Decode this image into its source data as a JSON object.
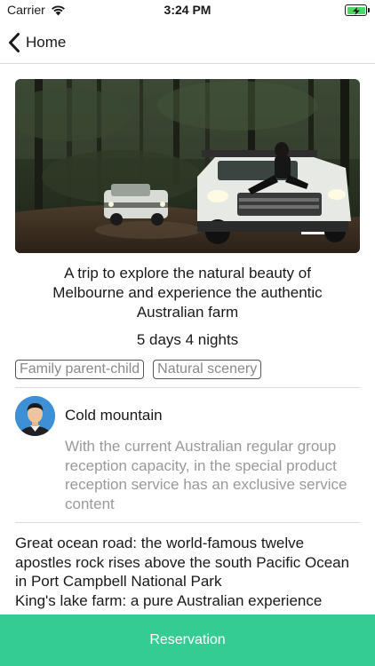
{
  "status_bar": {
    "carrier": "Carrier",
    "time": "3:24 PM",
    "battery_color": "#4cd964"
  },
  "nav": {
    "back_label": "Home",
    "back_icon": "chevron-left-icon"
  },
  "trip": {
    "title": "A trip to explore the natural beauty of Melbourne and experience the authentic Australian farm",
    "duration": "5 days 4 nights",
    "tags": [
      "Family parent-child",
      "Natural scenery"
    ]
  },
  "author": {
    "name": "Cold mountain",
    "description": "With the current Australian regular group reception capacity, in the special product reception service has an exclusive service content"
  },
  "description": "Great ocean road: the world-famous twelve apostles rock rises above the south Pacific Ocean in Port Campbell National Park\nKing's lake farm: a pure Australian experience",
  "actions": {
    "reserve_label": "Reservation",
    "accent_color": "#35cc94"
  }
}
